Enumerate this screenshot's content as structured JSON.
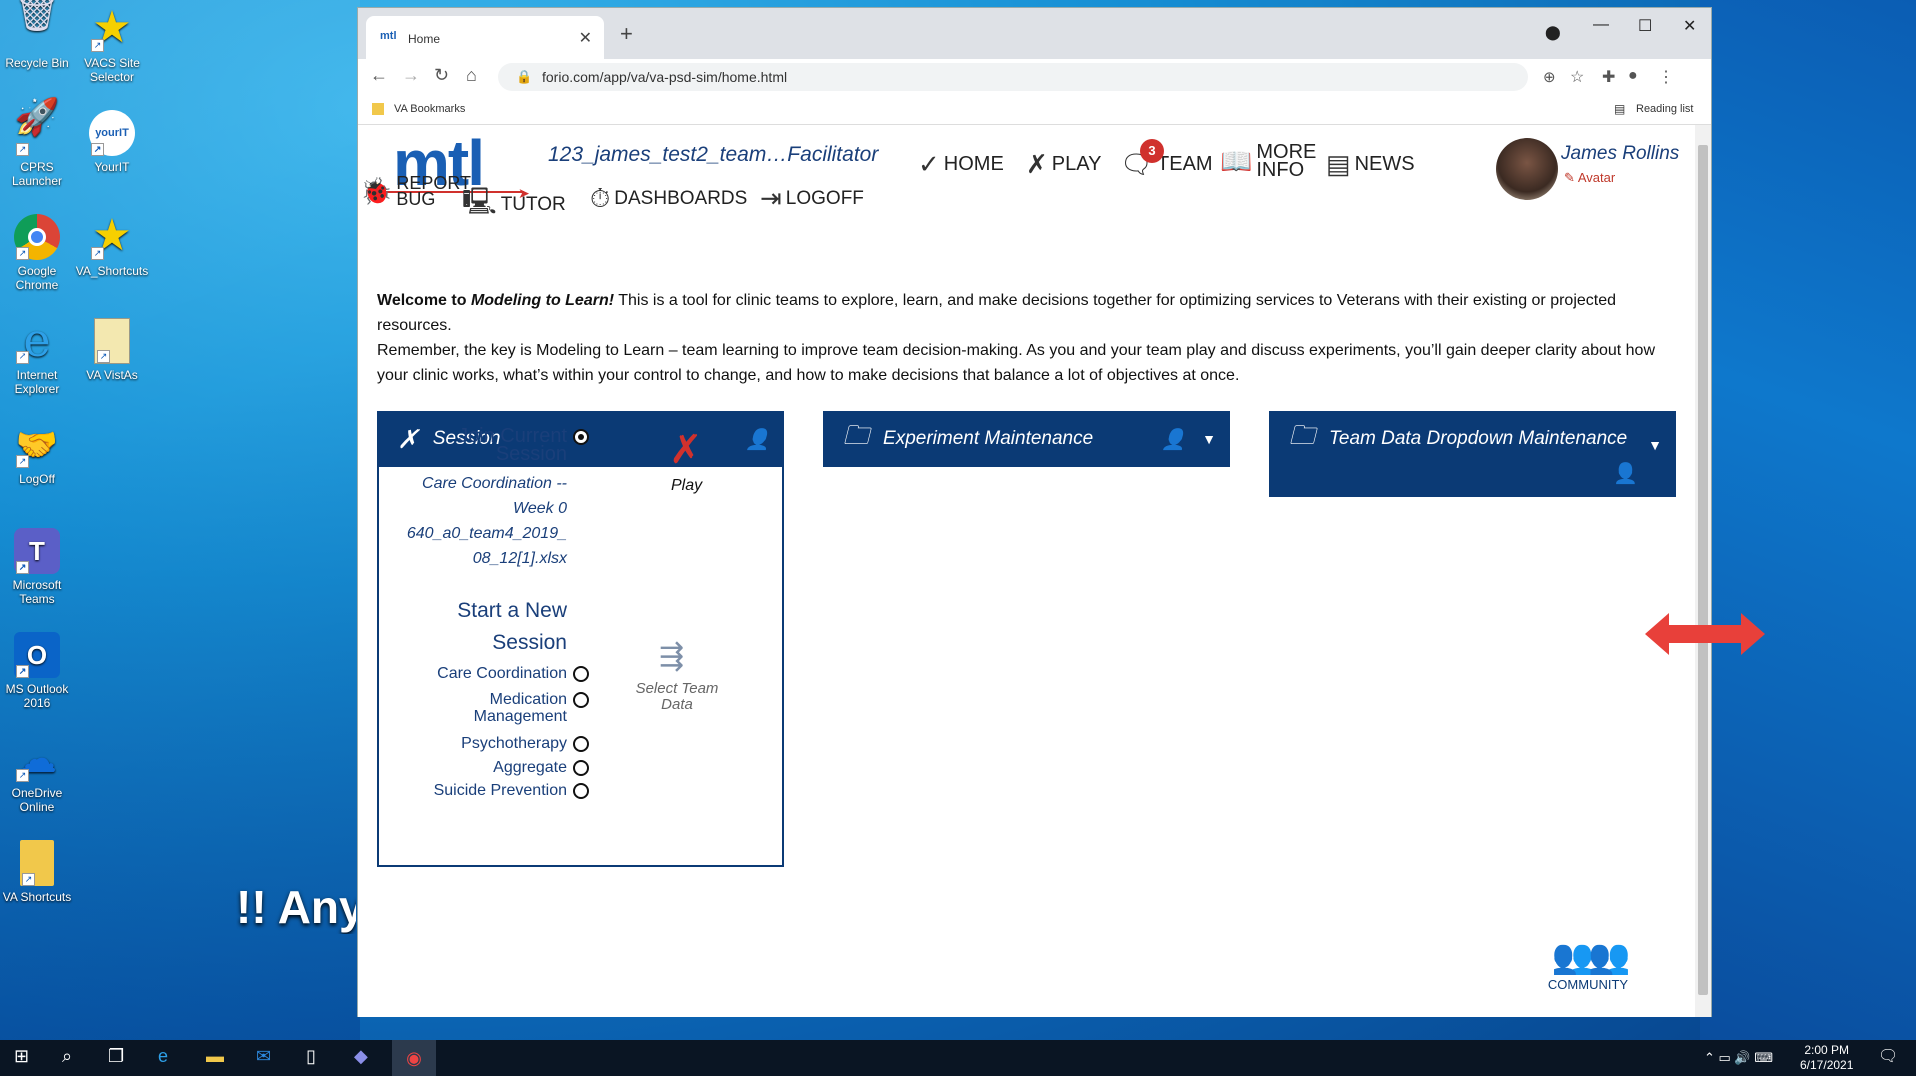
{
  "desktop": {
    "icons": [
      {
        "label": "Recycle Bin",
        "glyph": "🗑"
      },
      {
        "label": "VACS Site Selector",
        "glyph": "★"
      },
      {
        "label": "CPRS Launcher",
        "glyph": "🚀"
      },
      {
        "label": "YourIT",
        "glyph": "yourIT"
      },
      {
        "label": "Google Chrome",
        "glyph": "◉"
      },
      {
        "label": "VA_Shortcuts",
        "glyph": "★"
      },
      {
        "label": "Internet Explorer",
        "glyph": "e"
      },
      {
        "label": "VA VistAs",
        "glyph": "▤"
      },
      {
        "label": "LogOff",
        "glyph": "🤝"
      },
      {
        "label": "Microsoft Teams",
        "glyph": "T"
      },
      {
        "label": "MS Outlook 2016",
        "glyph": "O"
      },
      {
        "label": "OneDrive Online",
        "glyph": "☁"
      },
      {
        "label": "VA Shortcuts",
        "glyph": "▮"
      }
    ],
    "banner_text": "!! Any"
  },
  "browser": {
    "tab_title": "Home",
    "tab_favicon": "mtl",
    "url": "forio.com/app/va/va-psd-sim/home.html",
    "bookmark": "VA Bookmarks",
    "reading_list": "Reading list"
  },
  "app": {
    "logo": "mtl",
    "team_title": "123_james_test2_team…Facilitator",
    "menu": {
      "home": "HOME",
      "play": "PLAY",
      "team": "TEAM",
      "team_badge": "3",
      "more_info_1": "MORE",
      "more_info_2": "INFO",
      "news": "NEWS",
      "report_bug_1": "REPORT",
      "report_bug_2": "BUG",
      "tutor": "TUTOR",
      "dashboards": "DASHBOARDS",
      "logoff": "LOGOFF"
    },
    "user": {
      "name": "James Rollins",
      "avatar_link": "Avatar"
    },
    "welcome": {
      "lead": "Welcome to ",
      "italic": "Modeling to Learn!",
      "rest": " This is a tool for clinic teams to explore, learn, and make decisions together for optimizing services to Veterans with their existing or projected resources.",
      "para2": "Remember, the key is Modeling to Learn – team learning to improve team decision-making. As you and your team play and discuss experiments, you’ll gain deeper clarity about how your clinic works, what’s within your control to change, and how to make decisions that balance a lot of objectives at once."
    },
    "session_panel": {
      "title": "Session",
      "join_1": "Join Current",
      "join_2": "Session",
      "current_1": "Care Coordination --",
      "current_2": "Week 0",
      "current_3": "640_a0_team4_2019_",
      "current_4": "08_12[1].xlsx",
      "play_label": "Play",
      "new_1": "Start a New",
      "new_2": "Session",
      "options": [
        "Care Coordination",
        "Medication",
        "Management",
        "Psychotherapy",
        "Aggregate",
        "Suicide Prevention"
      ],
      "select_data_1": "Select Team",
      "select_data_2": "Data"
    },
    "experiment_panel": {
      "title": "Experiment Maintenance"
    },
    "teamdata_panel": {
      "title": "Team Data Dropdown Maintenance"
    },
    "community": "COMMUNITY"
  },
  "taskbar": {
    "time": "2:00 PM",
    "date": "6/17/2021"
  }
}
